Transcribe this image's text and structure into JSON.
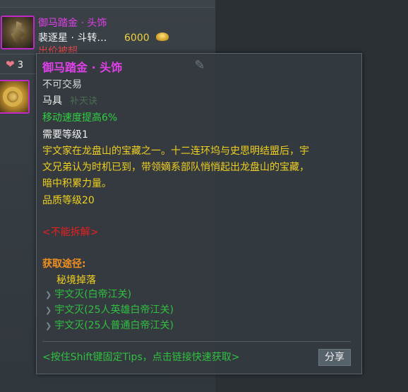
{
  "listing": {
    "item1": {
      "name": "御马踏金 · 头饰",
      "seller": "裴逐星 · 斗转…",
      "price": "6000",
      "bid_status": "出价被超"
    },
    "likes": "3"
  },
  "tooltip": {
    "title": "御马踏金 · 头饰",
    "tradeable": "不可交易",
    "item_type": "马具",
    "item_slot": "补天诀",
    "stat": "移动速度提高6%",
    "required_level": "需要等级1",
    "description_lines": [
      "宇文家在龙盘山的宝藏之一。十二连环坞与史思明结盟后，宇",
      "文兄弟认为时机已到，带领嫡系部队悄悄起出龙盘山的宝藏，",
      "暗中积累力量。"
    ],
    "quality_level": "品质等级20",
    "disassemble": "<不能拆解>",
    "source_title": "获取途径:",
    "source_category": "秘境掉落",
    "sources": [
      "宇文灭(白帝江关)",
      "宇文灭(25人英雄白帝江关)",
      "宇文灭(25人普通白帝江关)"
    ],
    "footer_hint": "<按住Shift键固定Tips，点击链接快速获取>",
    "share_label": "分享"
  }
}
